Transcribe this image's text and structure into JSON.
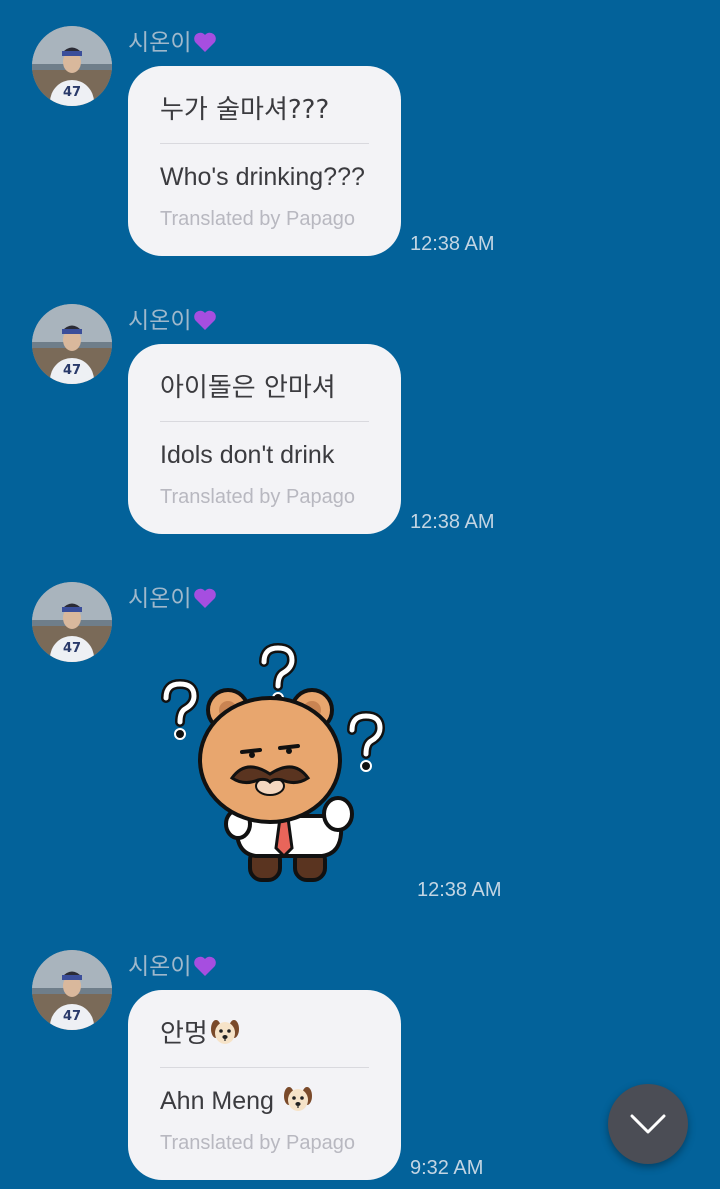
{
  "messages": [
    {
      "sender": "시온이",
      "original": "누가 술마셔???",
      "translated": "Who's drinking???",
      "credit": "Translated by Papago",
      "time": "12:38 AM"
    },
    {
      "sender": "시온이",
      "original": "아이돌은 안마셔",
      "translated": "Idols don't drink",
      "credit": "Translated by Papago",
      "time": "12:38 AM"
    },
    {
      "sender": "시온이",
      "sticker": "confused-bear-mustache-sticker",
      "time": "12:38 AM"
    },
    {
      "sender": "시온이",
      "original": "안멍",
      "translated": "Ahn Meng",
      "credit": "Translated by Papago",
      "time": "9:32 AM"
    }
  ],
  "icons": {
    "heart": "purple-heart-icon",
    "dog": "dog-face-icon",
    "scroll_down": "chevron-down-icon"
  },
  "colors": {
    "background": "#03629a",
    "bubble": "#f3f3f6",
    "sender_text": "#9fb8cb",
    "time_text": "#c3d5e3",
    "fab": "#4b4d55"
  }
}
